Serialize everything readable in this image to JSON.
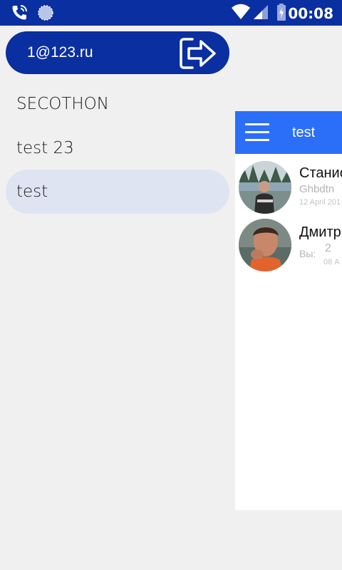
{
  "status_bar": {
    "time": "00:08",
    "icons": [
      "phone-call-icon",
      "sync-icon",
      "wifi-icon",
      "signal-icon",
      "battery-charging-icon"
    ]
  },
  "drawer": {
    "account_email": "1@123.ru",
    "logout_icon": "logout-arrow-icon",
    "items": [
      {
        "label": "SECOTHON",
        "active": false
      },
      {
        "label": "test 23",
        "active": false
      },
      {
        "label": "test",
        "active": true
      }
    ]
  },
  "main": {
    "toolbar_title": "test",
    "menu_icon": "hamburger-menu-icon",
    "chats": [
      {
        "name": "Станис",
        "preview": "Ghbdtn",
        "date": "12 April 201"
      },
      {
        "name": "Дмитр",
        "preview_prefix": "Вы:",
        "preview": "2",
        "date": "08 А"
      }
    ]
  },
  "colors": {
    "status_bar": "#0a2fa0",
    "toolbar": "#2b6ef7",
    "account_pill": "#0a2fa0",
    "active_item": "#dfe4f3",
    "background": "#f0f0f0"
  }
}
